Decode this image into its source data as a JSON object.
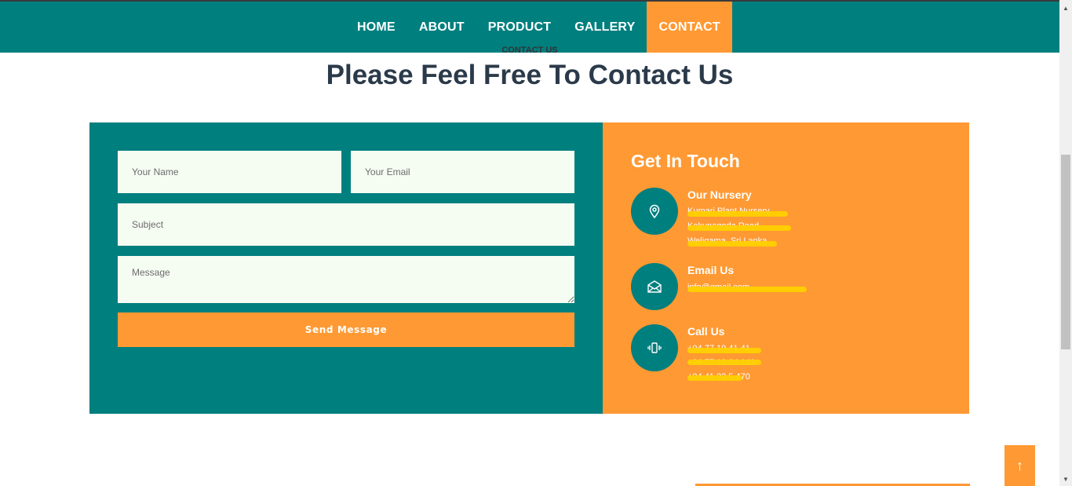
{
  "nav": {
    "items": [
      {
        "label": "HOME"
      },
      {
        "label": "ABOUT"
      },
      {
        "label": "PRODUCT"
      },
      {
        "label": "GALLERY"
      },
      {
        "label": "CONTACT",
        "active": true
      }
    ]
  },
  "header": {
    "kicker": "CONTACT US",
    "title": "Please Feel Free To Contact Us"
  },
  "form": {
    "name_placeholder": "Your Name",
    "email_placeholder": "Your Email",
    "subject_placeholder": "Subject",
    "message_placeholder": "Message",
    "send_label": "Send Message"
  },
  "info": {
    "title": "Get In Touch",
    "nursery": {
      "title": "Our Nursery",
      "icon": "map-pin-icon",
      "lines": [
        "Kumari Plant Nursery,",
        "Kekunagoda Road,",
        "Weligama, Sri Lanka"
      ]
    },
    "email": {
      "title": "Email Us",
      "icon": "envelope-icon",
      "lines": [
        "info@gmail.com"
      ]
    },
    "call": {
      "title": "Call Us",
      "icon": "phone-vibrate-icon",
      "lines": [
        "+94 77 19 41 41",
        "+94 77 19 64 141",
        "+94 41 22 5 470"
      ]
    }
  },
  "scroll_top": {
    "icon": "arrow-up-icon",
    "glyph": "↑"
  },
  "colors": {
    "teal": "#007f7f",
    "orange": "#ff9933",
    "field_bg": "#f5fcf2",
    "heading": "#2b3a4a"
  }
}
